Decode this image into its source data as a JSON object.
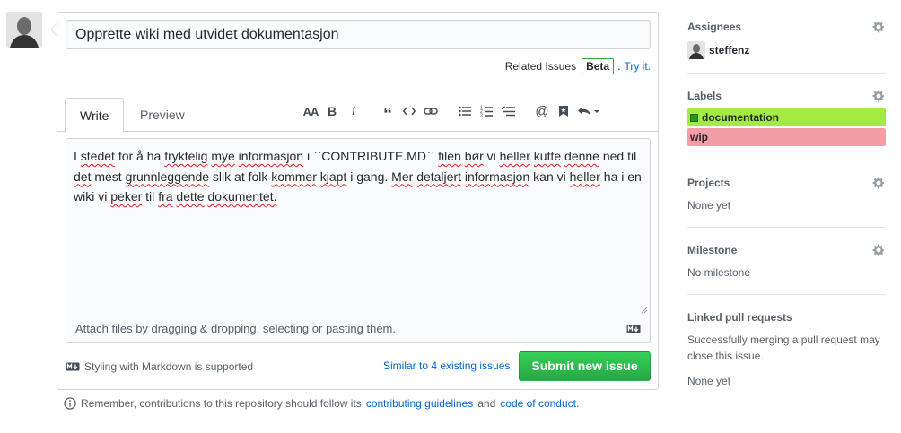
{
  "issue": {
    "title_value": "Opprette wiki med utvidet dokumentasjon",
    "related": {
      "text": "Related Issues",
      "badge": "Beta",
      "period": ".",
      "link": "Try it."
    },
    "tabs": [
      {
        "label": "Write"
      },
      {
        "label": "Preview"
      }
    ],
    "body_words": [
      "I",
      "stedet",
      "for",
      "å",
      "ha",
      "fryktelig",
      "mye",
      "informasjon",
      "i",
      "``CONTRIBUTE.MD``",
      "filen",
      "bør",
      "vi",
      "heller",
      "kutte",
      "denne",
      "ned",
      "til",
      "det",
      "mest",
      "grunnleggende",
      "slik",
      "at",
      "folk",
      "kommer",
      "kjapt",
      "i",
      "gang.",
      "Mer",
      "detaljert",
      "informasjon",
      "kan",
      "vi",
      "heller",
      "ha",
      "i",
      "en",
      "wiki",
      "vi",
      "peker",
      "til",
      "fra",
      "dette",
      "dokumentet."
    ],
    "misspelled_word_index": [
      1,
      5,
      6,
      7,
      10,
      11,
      13,
      14,
      15,
      18,
      20,
      24,
      25,
      28,
      29,
      30,
      33,
      39,
      41,
      42,
      43
    ],
    "attach_text": "Attach files by dragging & dropping, selecting or pasting them.",
    "markdown_note": "Styling with Markdown is supported",
    "similar": "Similar to 4 existing issues",
    "submit": "Submit new issue",
    "remember": {
      "before": "Remember, contributions to this repository should follow its",
      "link1": "contributing guidelines",
      "and": "and",
      "link2": "code of conduct",
      "after": "."
    }
  },
  "toolbar": {
    "icons": [
      "text-size-icon",
      "bold-icon",
      "italic-icon",
      "quote-icon",
      "code-icon",
      "link-icon",
      "bullet-list-icon",
      "numbered-list-icon",
      "task-list-icon",
      "mention-icon",
      "reference-icon",
      "reply-icon"
    ]
  },
  "sidebar": {
    "assignees": {
      "heading": "Assignees",
      "user": "steffenz"
    },
    "labels": {
      "heading": "Labels",
      "items": [
        {
          "name": "documentation",
          "color": "#a2eb42"
        },
        {
          "name": "wip",
          "color": "#f19ea6"
        }
      ]
    },
    "projects": {
      "heading": "Projects",
      "value": "None yet"
    },
    "milestone": {
      "heading": "Milestone",
      "value": "No milestone"
    },
    "linked": {
      "heading": "Linked pull requests",
      "desc": "Successfully merging a pull request may close this issue.",
      "value": "None yet"
    }
  },
  "colors": {
    "accent_link": "#0366d6",
    "submit_green": "#28a745",
    "border": "#d1d5da"
  }
}
